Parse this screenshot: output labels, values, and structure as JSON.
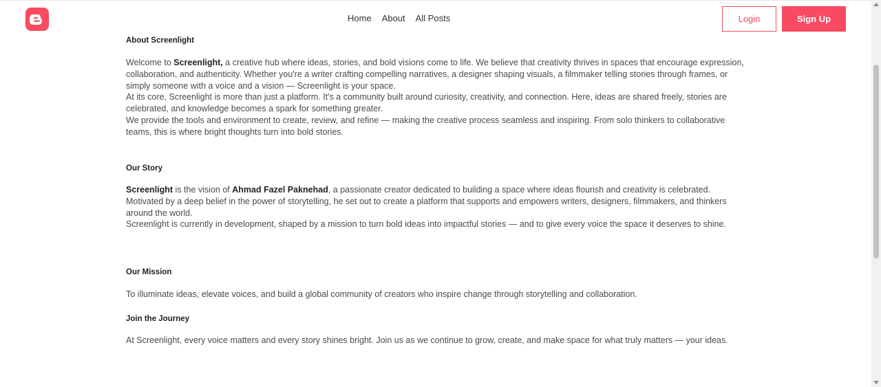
{
  "header": {
    "logo": "blogger-logo-icon",
    "nav": [
      "Home",
      "About",
      "All Posts"
    ],
    "login_label": "Login",
    "signup_label": "Sign Up",
    "accent_color": "#f84b62"
  },
  "about": {
    "title": "About Screenlight",
    "p1_pre": "Welcome to ",
    "p1_bold": "Screenlight,",
    "p1_post": " a creative hub where ideas, stories, and bold visions come to life. We believe that creativity thrives in spaces that encourage expression, collaboration, and authenticity. Whether you're a writer crafting compelling narratives, a designer shaping visuals, a filmmaker telling stories through frames, or simply someone with a voice and a vision — Screenlight is your space.",
    "p2": "At its core, Screenlight is more than just a platform. It's a community built around curiosity, creativity, and connection. Here, ideas are shared freely, stories are celebrated, and knowledge becomes a spark for something greater.",
    "p3": "We provide the tools and environment to create, review, and refine — making the creative process seamless and inspiring. From solo thinkers to collaborative teams, this is where bright thoughts turn into bold stories."
  },
  "story": {
    "title": "Our Story",
    "p1_bold1": "Screenlight",
    "p1_mid": " is the vision of ",
    "p1_bold2": "Ahmad Fazel Paknehad",
    "p1_post": ", a passionate creator dedicated to building a space where ideas flourish and creativity is celebrated. Motivated by a deep belief in the power of storytelling, he set out to create a platform that supports and empowers writers, designers, filmmakers, and thinkers around the world.",
    "p2": "Screenlight is currently in development, shaped by a mission to turn bold ideas into impactful stories — and to give every voice the space it deserves to shine."
  },
  "mission": {
    "title": "Our Mission",
    "p1": "To illuminate ideas, elevate voices, and build a global community of creators who inspire change through storytelling and collaboration."
  },
  "journey": {
    "title": "Join the Journey",
    "p1": "At Screenlight, every voice matters and every story shines bright. Join us as we continue to grow, create, and make space for what truly matters — your ideas."
  }
}
